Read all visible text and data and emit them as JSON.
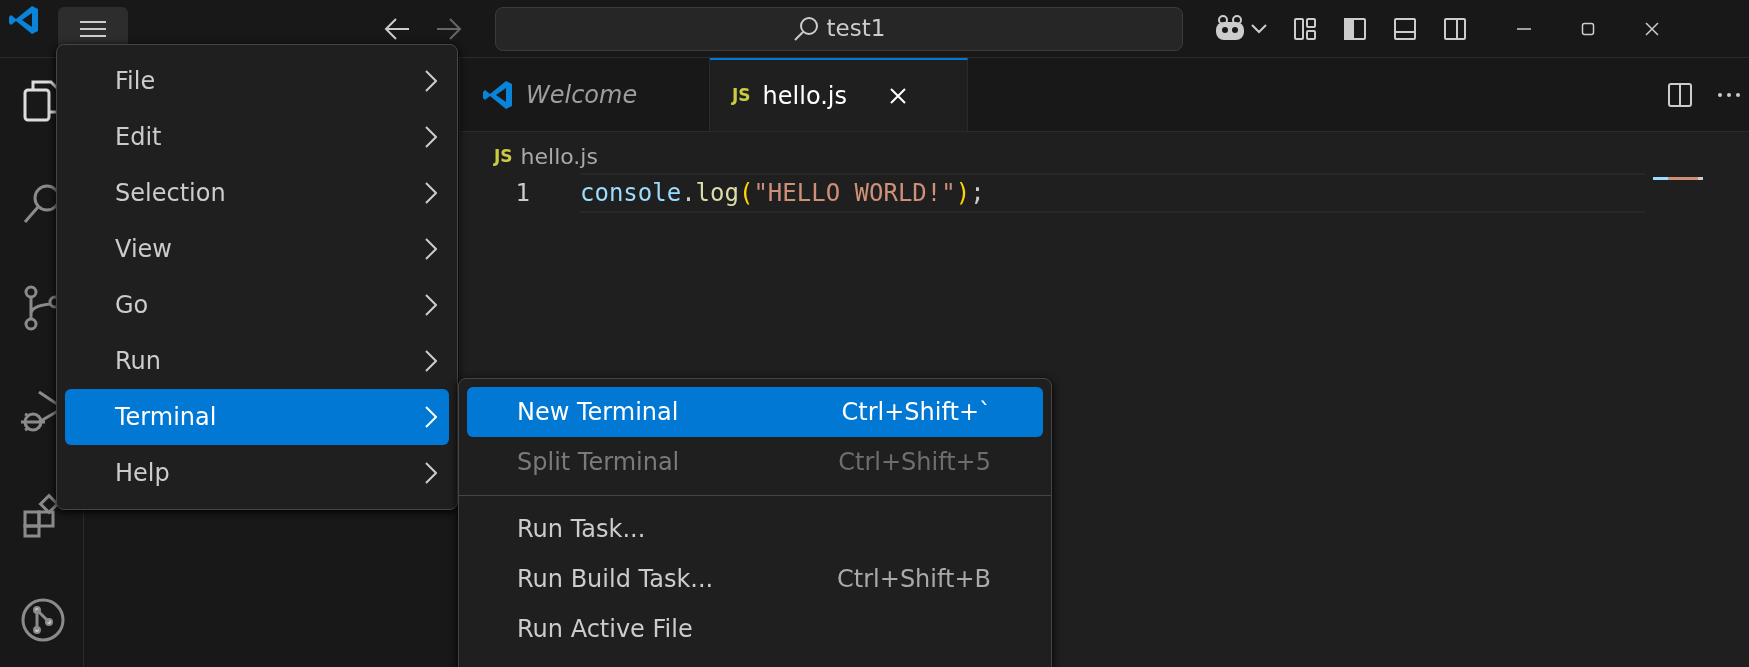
{
  "title_bar": {
    "search": "test1"
  },
  "tabs": [
    {
      "label": "Welcome",
      "kind": "welcome",
      "preview": true,
      "selected": false
    },
    {
      "label": "hello.js",
      "kind": "js",
      "file_badge": "JS",
      "preview": false,
      "selected": true
    }
  ],
  "breadcrumb": {
    "label": "hello.js",
    "kind": "js",
    "file_badge": "JS"
  },
  "code": [
    {
      "line": "1",
      "tokens": [
        {
          "text": "console",
          "color": "#9cdcfe"
        },
        {
          "text": ".",
          "color": "#cccccc"
        },
        {
          "text": "log",
          "color": "#dcdcaa"
        },
        {
          "text": "(",
          "color": "#ffd700"
        },
        {
          "text": "\"HELLO WORLD!\"",
          "color": "#ce9178"
        },
        {
          "text": ")",
          "color": "#ffd700"
        },
        {
          "text": ";",
          "color": "#cccccc"
        }
      ]
    }
  ],
  "menu": {
    "items": [
      {
        "label": "File",
        "selected": false
      },
      {
        "label": "Edit",
        "selected": false
      },
      {
        "label": "Selection",
        "selected": false
      },
      {
        "label": "View",
        "selected": false
      },
      {
        "label": "Go",
        "selected": false
      },
      {
        "label": "Run",
        "selected": false
      },
      {
        "label": "Terminal",
        "selected": true
      },
      {
        "label": "Help",
        "selected": false
      }
    ]
  },
  "submenu": {
    "items": [
      {
        "kind": "item",
        "label": "New Terminal",
        "shortcut": "Ctrl+Shift+`",
        "selected": true,
        "disabled": false
      },
      {
        "kind": "item",
        "label": "Split Terminal",
        "shortcut": "Ctrl+Shift+5",
        "selected": false,
        "disabled": true
      },
      {
        "kind": "separator"
      },
      {
        "kind": "item",
        "label": "Run Task...",
        "selected": false,
        "disabled": false
      },
      {
        "kind": "item",
        "label": "Run Build Task...",
        "shortcut": "Ctrl+Shift+B",
        "selected": false,
        "disabled": false
      },
      {
        "kind": "item",
        "label": "Run Active File",
        "selected": false,
        "disabled": false
      }
    ]
  }
}
